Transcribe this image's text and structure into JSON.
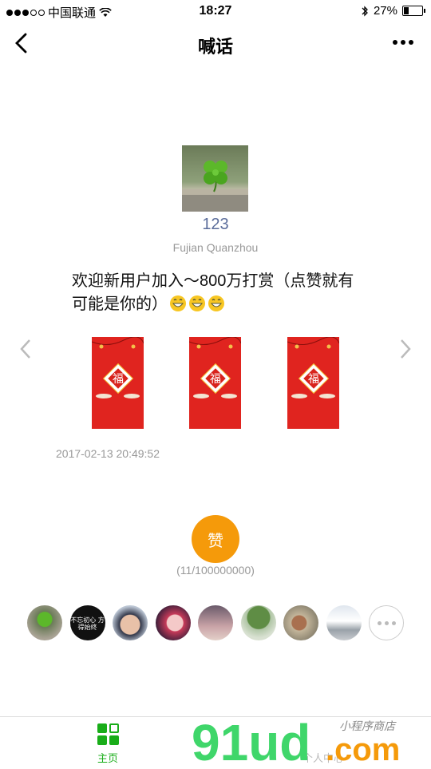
{
  "status_bar": {
    "carrier": "中国联通",
    "time": "18:27",
    "battery": "27%",
    "battery_level": 0.27
  },
  "nav": {
    "title": "喊话"
  },
  "profile": {
    "username": "123",
    "location": "Fujian Quanzhou"
  },
  "post": {
    "text": "欢迎新用户加入～800万打赏（点赞就有可能是你的）",
    "emoji_count": 3,
    "timestamp": "2017-02-13 20:49:52",
    "red_packets": 3
  },
  "likes": {
    "button_label": "赞",
    "count_text": "(11/100000000)",
    "avatar2_text": "不忘初心 方得始终",
    "liker_count": 9
  },
  "tabbar": {
    "home_label": "主页",
    "personal_label": "个人中心"
  },
  "watermark": {
    "brand": "91ud",
    "suffix": ".com",
    "tagline": "小程序商店"
  },
  "colors": {
    "accent_green": "#19ad19",
    "like_orange": "#f59a0a",
    "username_blue": "#5a6c9a",
    "red_packet": "#e0241f"
  }
}
